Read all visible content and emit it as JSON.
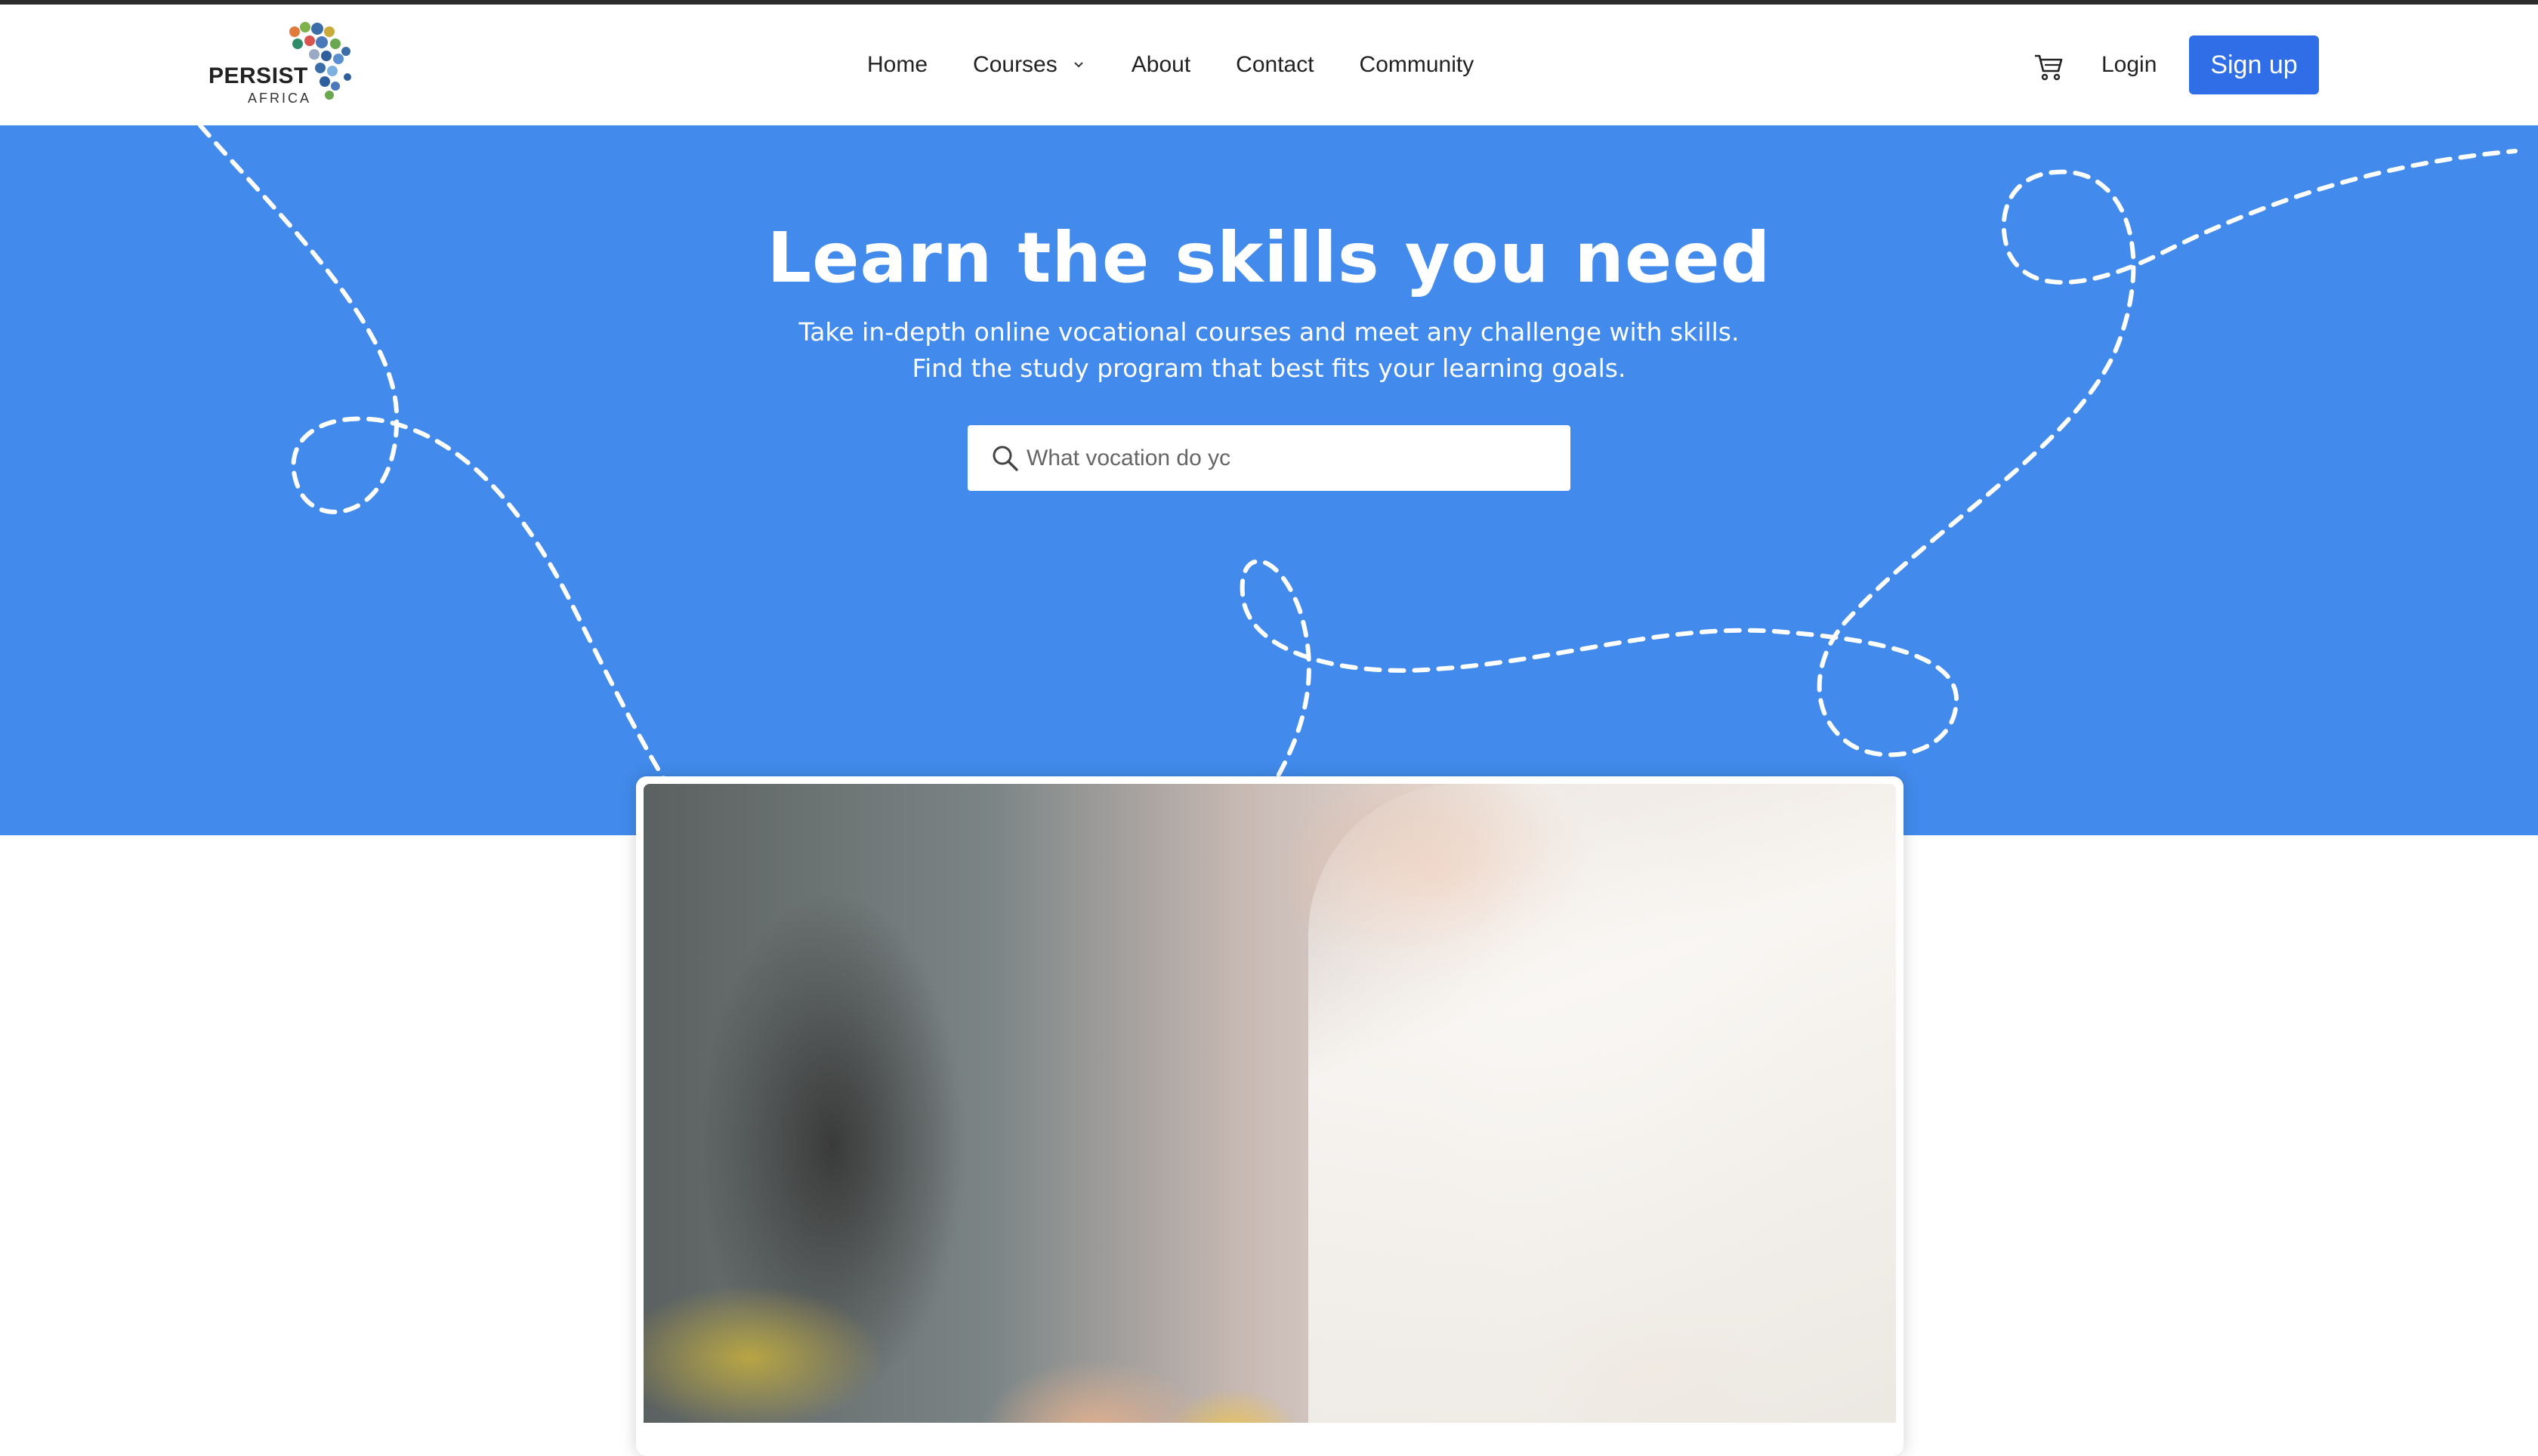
{
  "header": {
    "logo": {
      "brand": "PERSIST",
      "sub": "AFRICA"
    },
    "nav": [
      {
        "label": "Home"
      },
      {
        "label": "Courses"
      },
      {
        "label": "About"
      },
      {
        "label": "Contact"
      },
      {
        "label": "Community"
      }
    ],
    "login_label": "Login",
    "signup_label": "Sign up",
    "signup_color": "#2f6ee6"
  },
  "hero": {
    "title": "Learn the skills you need",
    "subtitle_line1": "Take in-depth online vocational courses and meet any challenge with skills.",
    "subtitle_line2": "Find the study program that best fits your learning goals.",
    "search_placeholder": "What vocation do yc",
    "background": "#428bec"
  },
  "icons": {
    "cart": "cart-icon",
    "search": "search-icon",
    "courses_dropdown": "chevron-down-icon"
  }
}
